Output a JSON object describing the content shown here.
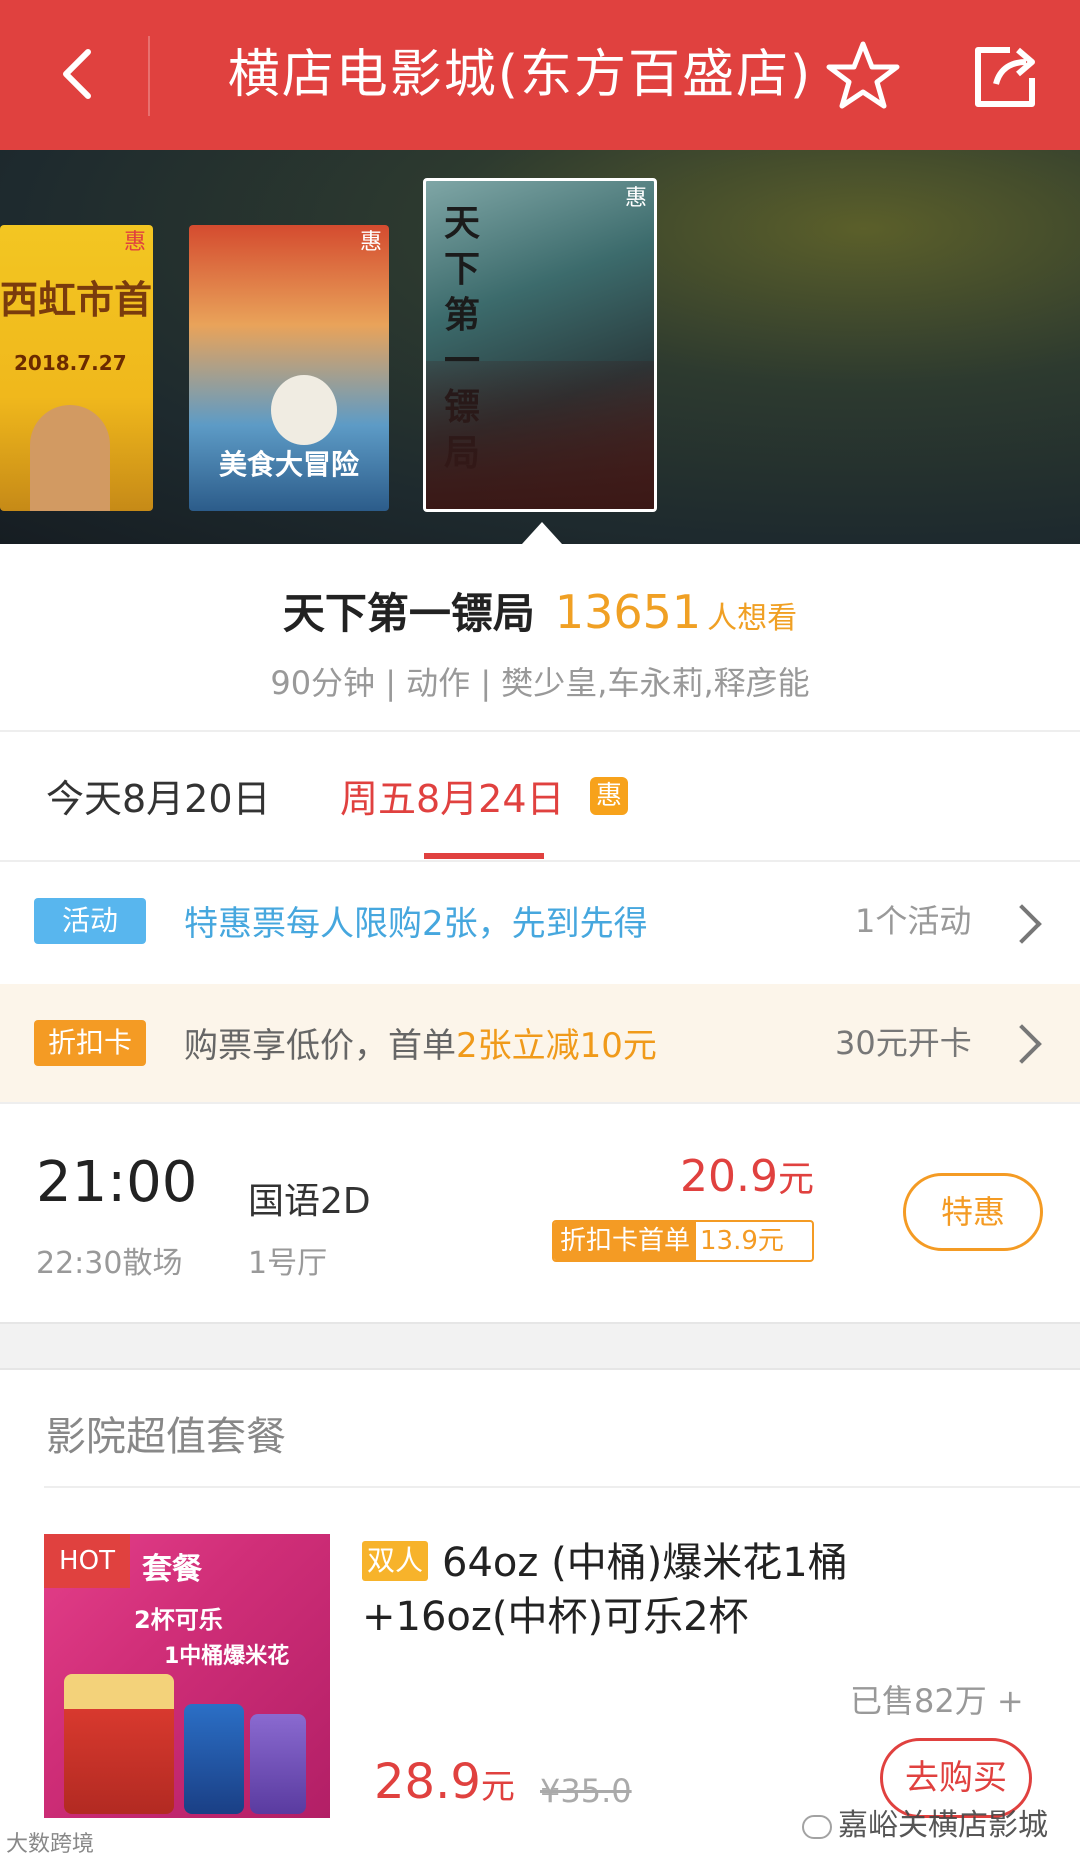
{
  "header": {
    "title": "横店电影城(东方百盛店)",
    "bg_color": "#e0413f"
  },
  "posters": [
    {
      "title": "西虹市首富",
      "date": "2018.7.27",
      "badge": "惠"
    },
    {
      "title": "美食大冒险",
      "badge": "惠"
    },
    {
      "title": "天下第一镖局",
      "badge": "惠",
      "selected": true
    }
  ],
  "movie": {
    "name": "天下第一镖局",
    "want_count": "13651",
    "want_label": "人想看",
    "meta": "90分钟 | 动作 | 樊少皇,车永莉,释彦能"
  },
  "dates": {
    "today": "今天8月20日",
    "friday": "周五8月24日",
    "friday_badge": "惠"
  },
  "activity": {
    "tag": "活动",
    "text": "特惠票每人限购2张，先到先得",
    "right": "1个活动"
  },
  "discount_card": {
    "tag": "折扣卡",
    "text_prefix": "购票享低价，首单",
    "text_highlight": "2张立减10元",
    "right": "30元开卡"
  },
  "showtime": {
    "start": "21:00",
    "end": "22:30散场",
    "lang": "国语2D",
    "hall": "1号厅",
    "price": "20.9",
    "price_unit": "元",
    "card_label": "折扣卡首单",
    "card_price": "13.9元",
    "button": "特惠"
  },
  "combo": {
    "section_title": "影院超值套餐",
    "image": {
      "hot": "HOT",
      "title": "套餐",
      "line1": "2杯可乐",
      "line2": "1中桶爆米花"
    },
    "tag": "双人",
    "name_line1": "64oz (中桶)爆米花1桶",
    "name_line2": "+16oz(中杯)可乐2杯",
    "sold": "已售82万 +",
    "price": "28.9",
    "price_unit": "元",
    "old_price": "¥35.0",
    "button": "去购买"
  },
  "watermarks": {
    "right": "嘉峪关横店影城",
    "left": "大数跨境"
  }
}
